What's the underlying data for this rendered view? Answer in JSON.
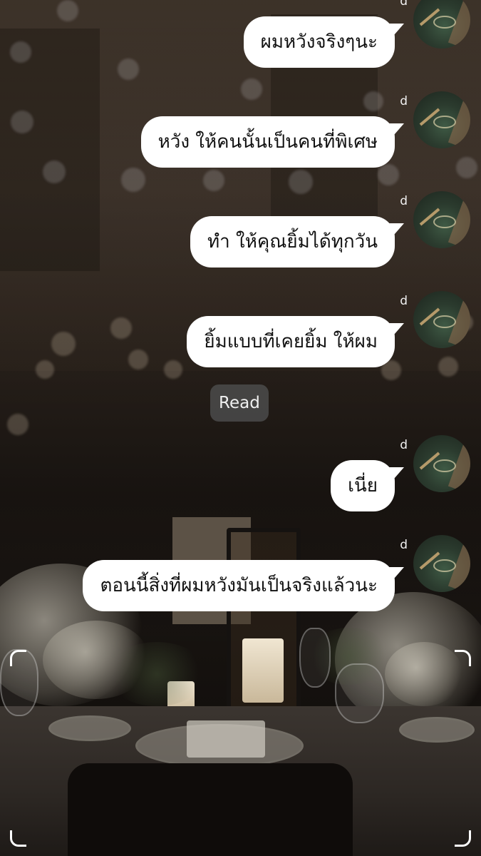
{
  "messages": [
    {
      "sender": "d",
      "text": "ผมหวังจริงๆนะ"
    },
    {
      "sender": "d",
      "text": "หวัง ให้คนนั้นเป็นคนที่พิเศษ"
    },
    {
      "sender": "d",
      "text": "ทำ ให้คุณยิ้มได้ทุกวัน"
    },
    {
      "sender": "d",
      "text": "ยิ้มแบบที่เคยยิ้ม ให้ผม"
    },
    {
      "sender": "d",
      "text": "เนี่ย"
    },
    {
      "sender": "d",
      "text": "ตอนนี้สิ่งที่ผมหวังมันเป็นจริงแล้วนะ"
    }
  ],
  "read_receipt": "Read",
  "icons": {
    "avatar": "profile-avatar",
    "viewfinder": "viewfinder-corner-icon"
  },
  "colors": {
    "bubble_bg": "#ffffff",
    "bubble_text": "#111111",
    "read_bg": "#4b4b4b"
  }
}
